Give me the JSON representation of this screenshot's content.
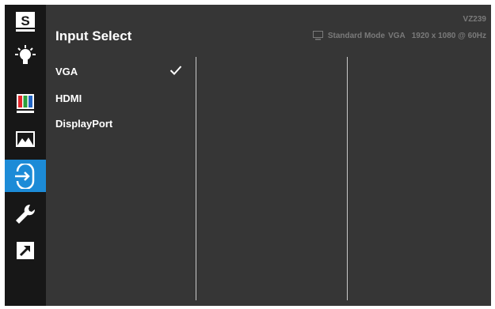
{
  "header": {
    "title": "Input Select",
    "model": "VZ239",
    "status": {
      "mode": "Standard Mode",
      "input": "VGA",
      "resolution": "1920 x 1080 @ 60Hz",
      "icon": "monitor-icon"
    }
  },
  "sidebar": {
    "items": [
      {
        "name": "splendid",
        "icon": "s-badge-icon",
        "active": false
      },
      {
        "name": "brightness",
        "icon": "bulb-icon",
        "active": false
      },
      {
        "name": "color",
        "icon": "color-bars-icon",
        "active": false
      },
      {
        "name": "image",
        "icon": "landscape-icon",
        "active": false
      },
      {
        "name": "input-select",
        "icon": "input-arrow-icon",
        "active": true
      },
      {
        "name": "system-setup",
        "icon": "wrench-icon",
        "active": false
      },
      {
        "name": "shortcut",
        "icon": "shortcut-arrow-icon",
        "active": false
      }
    ]
  },
  "options": {
    "items": [
      "VGA",
      "HDMI",
      "DisplayPort"
    ],
    "selected": "VGA"
  },
  "colors": {
    "sidebar_bg": "#171717",
    "main_bg": "#363636",
    "accent": "#1c8bd7",
    "text": "#ffffff",
    "muted": "#7a7a7a"
  }
}
